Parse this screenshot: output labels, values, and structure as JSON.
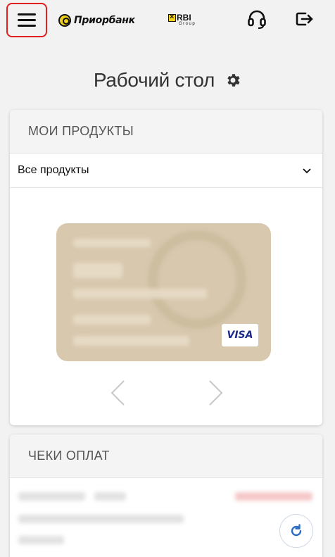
{
  "header": {
    "menu_icon": "hamburger-menu-icon",
    "brand_name": "Приорбанк",
    "partner_brand": "RBI",
    "partner_sub": "Group",
    "support_icon": "headset-icon",
    "logout_icon": "logout-icon"
  },
  "page": {
    "title": "Рабочий стол",
    "settings_icon": "gear-icon"
  },
  "products": {
    "heading": "МОИ ПРОДУКТЫ",
    "filter_selected": "Все продукты",
    "card_network": "VISA",
    "prev_icon": "chevron-left-icon",
    "next_icon": "chevron-right-icon"
  },
  "receipts": {
    "heading": "ЧЕКИ ОПЛАТ",
    "refresh_icon": "refresh-icon"
  },
  "colors": {
    "accent": "#e0201e",
    "brand_yellow": "#f3d21a",
    "card_color": "#d8c8ae",
    "refresh_blue": "#2a6bc4"
  }
}
